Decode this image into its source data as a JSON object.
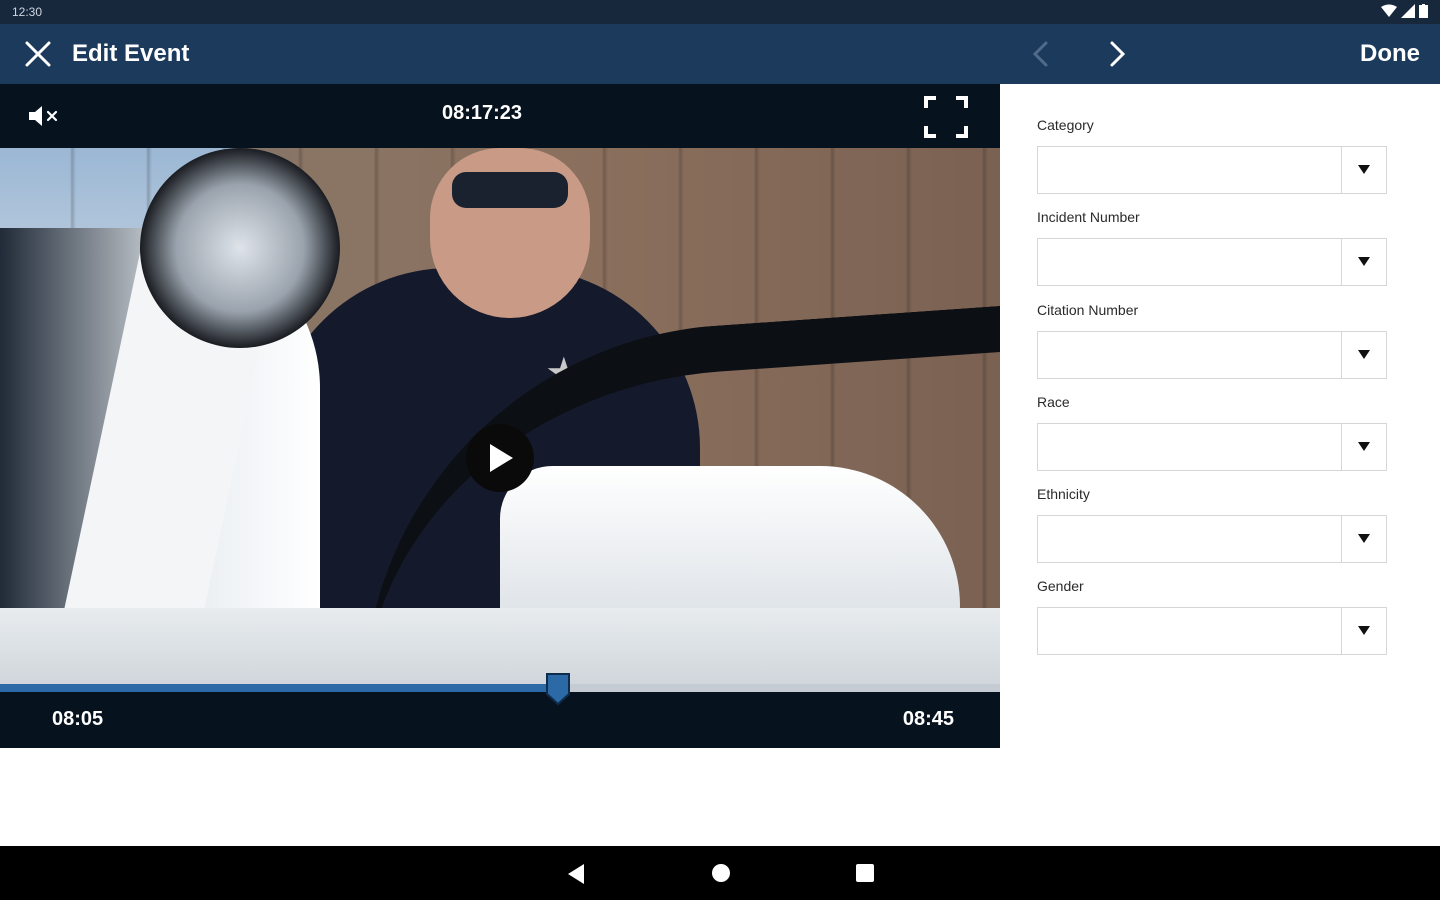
{
  "status_bar": {
    "time": "12:30"
  },
  "app_bar": {
    "title": "Edit Event",
    "done_label": "Done",
    "color": "#1b3a5c"
  },
  "player": {
    "timecode": "08:17:23",
    "start_time": "08:05",
    "end_time": "08:45",
    "progress": 0.558,
    "accent": "#2b6aa6"
  },
  "form": {
    "fields": [
      {
        "label": "Category",
        "value": ""
      },
      {
        "label": "Incident Number",
        "value": ""
      },
      {
        "label": "Citation Number",
        "value": ""
      },
      {
        "label": "Race",
        "value": ""
      },
      {
        "label": "Ethnicity",
        "value": ""
      },
      {
        "label": "Gender",
        "value": ""
      }
    ]
  }
}
